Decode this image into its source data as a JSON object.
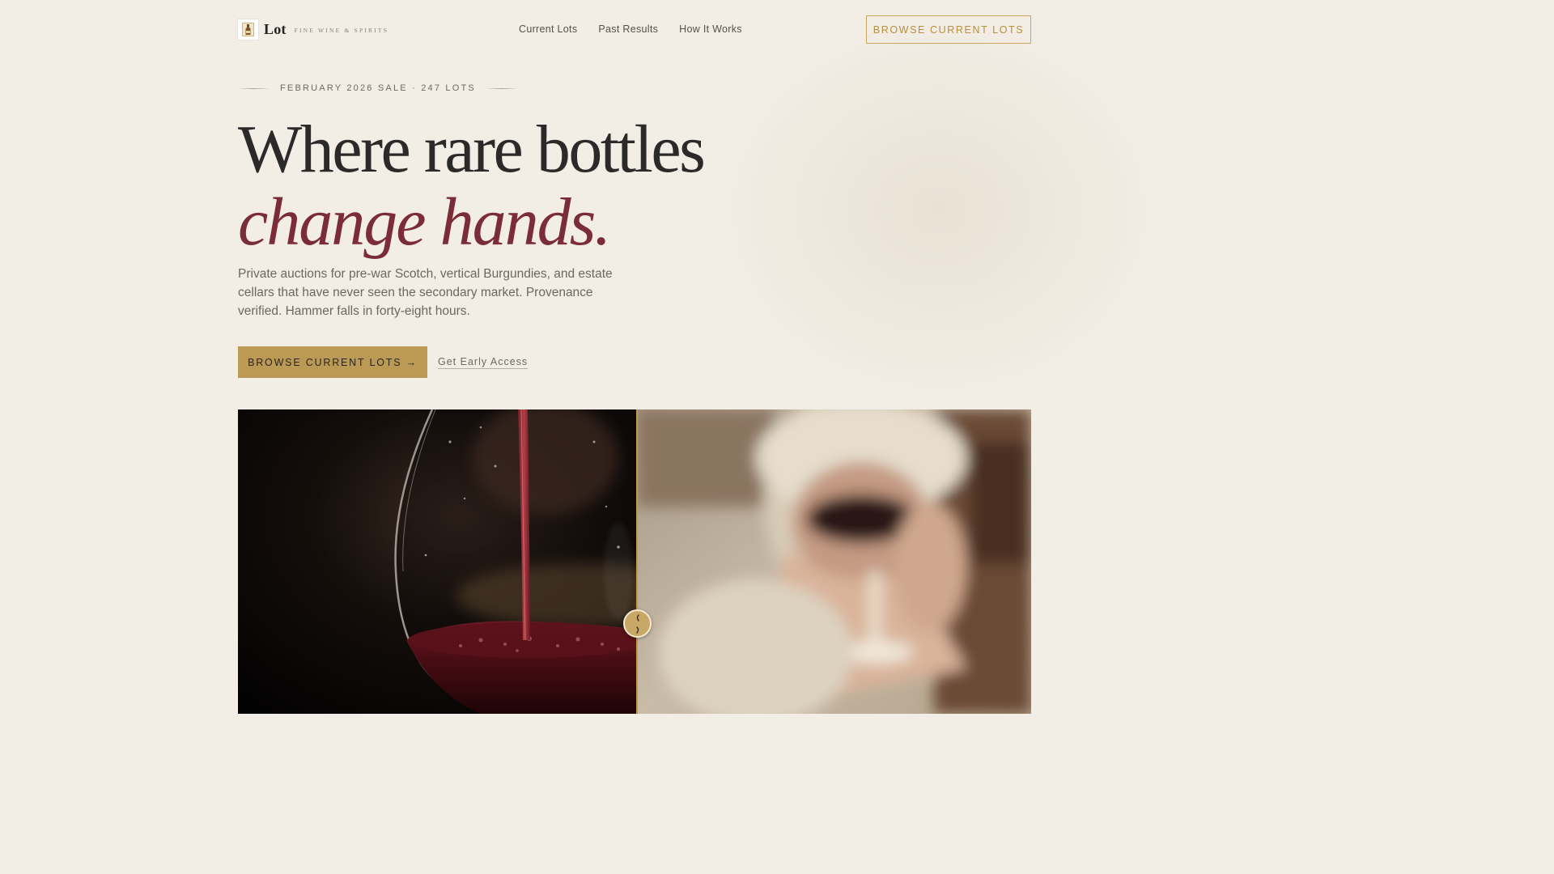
{
  "brand": {
    "name": "Lot",
    "tagline": "FINE WINE & SPIRITS",
    "logo_icon": "bottle-label-icon"
  },
  "nav": {
    "items": [
      {
        "label": "Current Lots"
      },
      {
        "label": "Past Results"
      },
      {
        "label": "How It Works"
      }
    ],
    "cta_label": "BROWSE CURRENT LOTS"
  },
  "hero": {
    "eyebrow": "FEBRUARY 2026 SALE · 247 LOTS",
    "headline_line1": "Where rare bottles",
    "headline_line2": "change hands.",
    "lede": "Private auctions for pre-war Scotch, vertical Burgundies, and estate cellars that have never seen the secondary market. Provenance verified. Hammer falls in forty-eight hours.",
    "primary_cta": "BROWSE CURRENT LOTS →",
    "secondary_cta": "Get Early Access"
  },
  "comparison": {
    "left_image": "wine-pour-glass-image",
    "right_image": "person-drinking-wine-image",
    "handle_icon": "slider-handle-icon",
    "split_position": 0.503
  },
  "colors": {
    "background": "#f2ede5",
    "gold": "#bb9a55",
    "burgundy": "#7a2d38",
    "ink": "#2b2a28"
  }
}
